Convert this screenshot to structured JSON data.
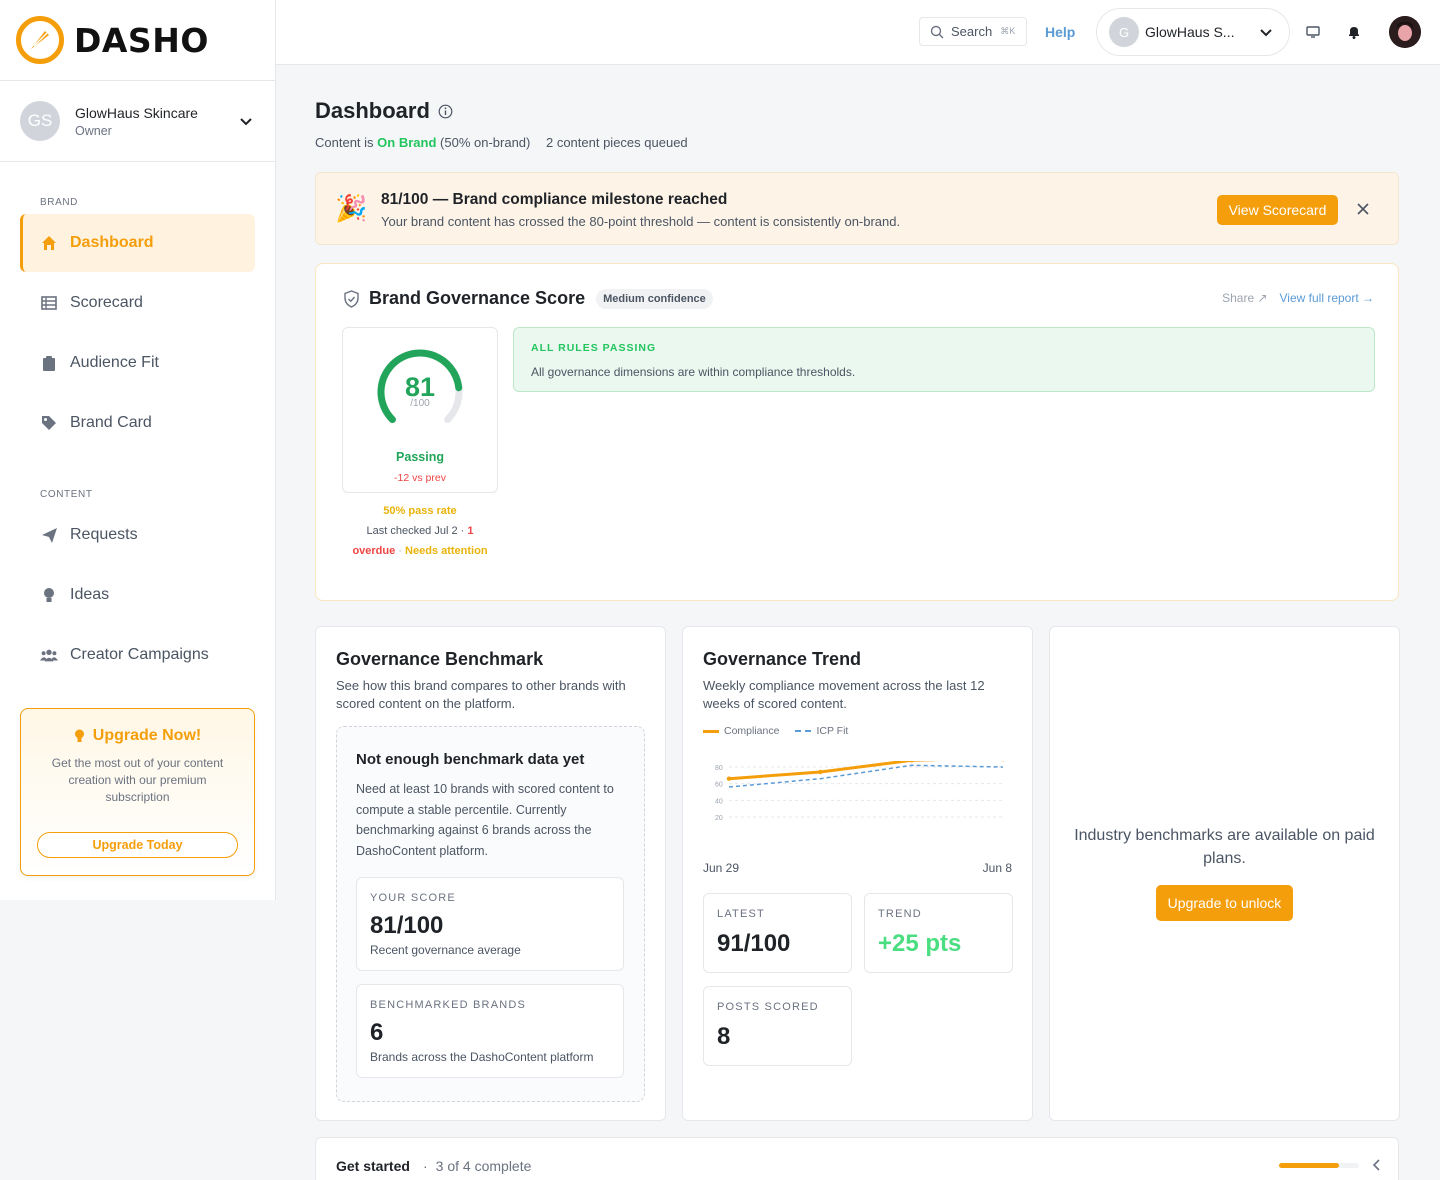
{
  "brand": {
    "logo_text": "DASHO",
    "accent": "#f59e0b"
  },
  "account": {
    "initials": "GS",
    "name": "GlowHaus Skincare",
    "role": "Owner"
  },
  "sidebar": {
    "sections": [
      {
        "label": "BRAND",
        "items": [
          {
            "label": "Dashboard",
            "icon": "home-icon",
            "active": true
          },
          {
            "label": "Scorecard",
            "icon": "table-icon"
          },
          {
            "label": "Audience Fit",
            "icon": "clipboard-icon"
          },
          {
            "label": "Brand Card",
            "icon": "tag-icon"
          }
        ]
      },
      {
        "label": "CONTENT",
        "items": [
          {
            "label": "Requests",
            "icon": "paper-plane-icon"
          },
          {
            "label": "Ideas",
            "icon": "lightbulb-icon"
          },
          {
            "label": "Creator Campaigns",
            "icon": "users-icon"
          }
        ]
      }
    ],
    "upgrade": {
      "title": "Upgrade Now!",
      "desc": "Get the most out of your content creation with our premium subscription",
      "button": "Upgrade Today"
    }
  },
  "topbar": {
    "search_label": "Search",
    "search_shortcut": "⌘K",
    "help": "Help",
    "brand_initial": "G",
    "brand_name": "GlowHaus S..."
  },
  "page": {
    "title": "Dashboard",
    "status_prefix": "Content is",
    "status_value": "On Brand",
    "status_pct": "(50% on-brand)",
    "queued": "2 content pieces queued"
  },
  "banner": {
    "emoji": "🎉",
    "title": "81/100 — Brand compliance milestone reached",
    "desc": "Your brand content has crossed the 80-point threshold — content is consistently on-brand.",
    "button": "View Scorecard"
  },
  "governance": {
    "title": "Brand Governance Score",
    "confidence": "Medium confidence",
    "share": "Share ↗",
    "report": "View full report →",
    "score": "81",
    "score_fraction": 0.81,
    "denominator": "/100",
    "status": "Passing",
    "delta": "-12 vs prev",
    "pass_rate": "50% pass rate",
    "last_checked": "Last checked Jul 2 ·",
    "overdue_count": "1",
    "overdue": "overdue",
    "needs_attention": "Needs attention",
    "rules_title": "ALL RULES PASSING",
    "rules_desc": "All governance dimensions are within compliance thresholds."
  },
  "benchmark": {
    "title": "Governance Benchmark",
    "desc": "See how this brand compares to other brands with scored content on the platform.",
    "empty_title": "Not enough benchmark data yet",
    "empty_desc": "Need at least 10 brands with scored content to compute a stable percentile. Currently benchmarking against 6 brands across the DashoContent platform.",
    "your_score_label": "YOUR SCORE",
    "your_score": "81/100",
    "your_score_sub": "Recent governance average",
    "brands_label": "BENCHMARKED BRANDS",
    "brands_value": "6",
    "brands_sub": "Brands across the DashoContent platform"
  },
  "trend": {
    "title": "Governance Trend",
    "desc": "Weekly compliance movement across the last 12 weeks of scored content.",
    "x_start": "Jun 29",
    "x_end": "Jun 8",
    "latest_label": "LATEST",
    "latest": "91/100",
    "trend_label": "TREND",
    "trend_value": "+25 pts",
    "posts_label": "POSTS SCORED",
    "posts_value": "8"
  },
  "chart_data": {
    "type": "line",
    "x": [
      1,
      2,
      3,
      4
    ],
    "series": [
      {
        "name": "Compliance",
        "color": "#f59e0b",
        "values": [
          66,
          74,
          88,
          91
        ]
      },
      {
        "name": "ICP Fit",
        "color": "#5b9bd5",
        "values": [
          56,
          66,
          82,
          80
        ]
      }
    ],
    "y_ticks": [
      "80",
      "60",
      "40",
      "20"
    ],
    "ylim": [
      20,
      80
    ],
    "grid": true,
    "legend": "top-left"
  },
  "industry": {
    "message": "Industry benchmarks are available on paid plans.",
    "button": "Upgrade to unlock"
  },
  "get_started": {
    "title": "Get started",
    "separator": "·",
    "progress_text": "3 of 4 complete",
    "progress_fraction": 0.75
  }
}
